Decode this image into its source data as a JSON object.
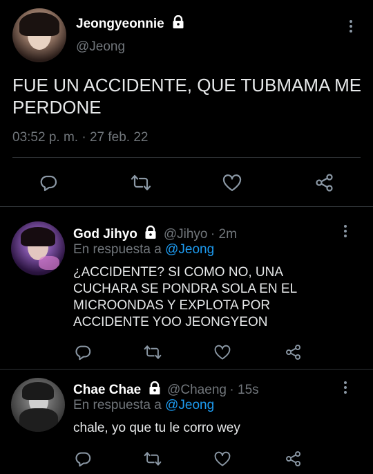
{
  "main_tweet": {
    "display_name": "Jeongyeonnie",
    "handle": "@Jeong",
    "text_line1": "FUE UN ACCIDENTE, QUE TUBMAMA ME",
    "text_line2": "PERDONE",
    "timestamp": "03:52 p. m. · 27 feb. 22"
  },
  "replies": [
    {
      "display_name": "God Jihyo",
      "handle": "@Jihyo",
      "time": "· 2m",
      "reply_prefix": "En respuesta a",
      "reply_to": "@Jeong",
      "lines": [
        "¿ACCIDENTE? SI COMO NO, UNA",
        "CUCHARA SE PONDRA SOLA EN EL",
        "MICROONDAS Y EXPLOTA POR",
        "ACCIDENTE YOO JEONGYEON"
      ]
    },
    {
      "display_name": "Chae Chae",
      "handle": "@Chaeng",
      "time": "· 15s",
      "reply_prefix": "En respuesta a",
      "reply_to": "@Jeong",
      "lines": [
        "chale, yo que tu le corro wey"
      ]
    }
  ],
  "icons": {
    "reply": "reply-bubble-icon",
    "retweet": "retweet-icon",
    "like": "heart-icon",
    "share": "share-icon",
    "lock": "lock-icon",
    "more": "more-vertical-icon"
  },
  "colors": {
    "background": "#000000",
    "text": "#e7e9ea",
    "muted": "#71767b",
    "link": "#1d9bf0",
    "divider": "#2f3336",
    "icon": "#8b98a5"
  }
}
